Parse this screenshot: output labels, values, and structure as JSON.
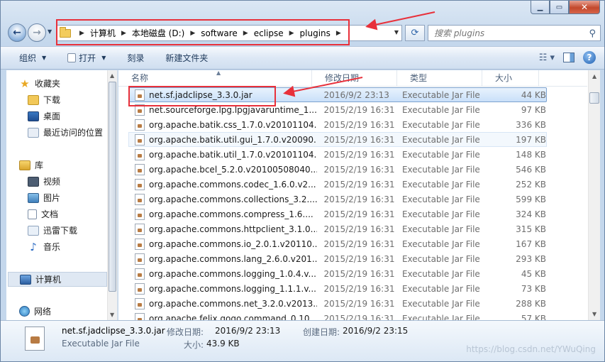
{
  "breadcrumb": [
    "计算机",
    "本地磁盘 (D:)",
    "software",
    "eclipse",
    "plugins"
  ],
  "search": {
    "placeholder": "搜索 plugins"
  },
  "toolbar": {
    "organize": "组织",
    "open": "打开",
    "burn": "刻录",
    "new_folder": "新建文件夹"
  },
  "sidebar": {
    "favorites": {
      "label": "收藏夹",
      "items": [
        "下载",
        "桌面",
        "最近访问的位置"
      ]
    },
    "libraries": {
      "label": "库",
      "items": [
        "视频",
        "图片",
        "文档",
        "迅雷下载",
        "音乐"
      ]
    },
    "computer": "计算机",
    "network": "网络"
  },
  "columns": {
    "name": "名称",
    "date": "修改日期",
    "type": "类型",
    "size": "大小"
  },
  "files": [
    {
      "name": "net.sf.jadclipse_3.3.0.jar",
      "date": "2016/9/2 23:13",
      "type": "Executable Jar File",
      "size": "44 KB"
    },
    {
      "name": "net.sourceforge.lpg.lpgjavaruntime_1...",
      "date": "2015/2/19 16:31",
      "type": "Executable Jar File",
      "size": "97 KB"
    },
    {
      "name": "org.apache.batik.css_1.7.0.v20101104...",
      "date": "2015/2/19 16:31",
      "type": "Executable Jar File",
      "size": "336 KB"
    },
    {
      "name": "org.apache.batik.util.gui_1.7.0.v20090...",
      "date": "2015/2/19 16:31",
      "type": "Executable Jar File",
      "size": "197 KB"
    },
    {
      "name": "org.apache.batik.util_1.7.0.v20101104...",
      "date": "2015/2/19 16:31",
      "type": "Executable Jar File",
      "size": "148 KB"
    },
    {
      "name": "org.apache.bcel_5.2.0.v20100508040...",
      "date": "2015/2/19 16:31",
      "type": "Executable Jar File",
      "size": "546 KB"
    },
    {
      "name": "org.apache.commons.codec_1.6.0.v2...",
      "date": "2015/2/19 16:31",
      "type": "Executable Jar File",
      "size": "252 KB"
    },
    {
      "name": "org.apache.commons.collections_3.2....",
      "date": "2015/2/19 16:31",
      "type": "Executable Jar File",
      "size": "599 KB"
    },
    {
      "name": "org.apache.commons.compress_1.6....",
      "date": "2015/2/19 16:31",
      "type": "Executable Jar File",
      "size": "324 KB"
    },
    {
      "name": "org.apache.commons.httpclient_3.1.0....",
      "date": "2015/2/19 16:31",
      "type": "Executable Jar File",
      "size": "315 KB"
    },
    {
      "name": "org.apache.commons.io_2.0.1.v20110...",
      "date": "2015/2/19 16:31",
      "type": "Executable Jar File",
      "size": "167 KB"
    },
    {
      "name": "org.apache.commons.lang_2.6.0.v201...",
      "date": "2015/2/19 16:31",
      "type": "Executable Jar File",
      "size": "293 KB"
    },
    {
      "name": "org.apache.commons.logging_1.0.4.v...",
      "date": "2015/2/19 16:31",
      "type": "Executable Jar File",
      "size": "45 KB"
    },
    {
      "name": "org.apache.commons.logging_1.1.1.v...",
      "date": "2015/2/19 16:31",
      "type": "Executable Jar File",
      "size": "73 KB"
    },
    {
      "name": "org.apache.commons.net_3.2.0.v2013...",
      "date": "2015/2/19 16:31",
      "type": "Executable Jar File",
      "size": "288 KB"
    },
    {
      "name": "org.apache.felix.gogo.command_0.10....",
      "date": "2015/2/19 16:31",
      "type": "Executable Jar File",
      "size": "57 KB"
    }
  ],
  "details": {
    "name": "net.sf.jadclipse_3.3.0.jar",
    "type": "Executable Jar File",
    "modified_label": "修改日期:",
    "modified_value": "2016/9/2 23:13",
    "created_label": "创建日期:",
    "created_value": "2016/9/2 23:15",
    "size_label": "大小:",
    "size_value": "43.9 KB"
  },
  "watermark": "https://blog.csdn.net/YWuQing",
  "colors": {
    "highlight": "#e8303a",
    "selection": "#c9e0f9",
    "accent": "#1e395b"
  }
}
